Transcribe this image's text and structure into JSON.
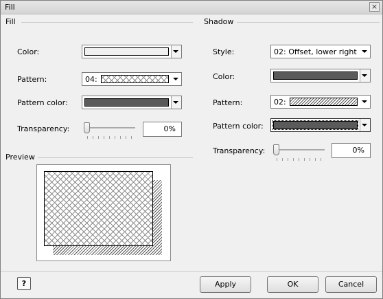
{
  "window": {
    "title": "Fill",
    "close_glyph": "×"
  },
  "fill": {
    "group_label": "Fill",
    "color_label": "Color:",
    "pattern_label": "Pattern:",
    "pattern_value": "04:",
    "pattern_color_label": "Pattern color:",
    "transparency_label": "Transparency:",
    "transparency_value": "0%",
    "color_swatch": "#f0f0f0",
    "pattern_color_swatch": "#5a5a5a"
  },
  "shadow": {
    "group_label": "Shadow",
    "style_label": "Style:",
    "style_value": "02: Offset, lower right",
    "color_label": "Color:",
    "pattern_label": "Pattern:",
    "pattern_value": "02:",
    "pattern_color_label": "Pattern color:",
    "transparency_label": "Transparency:",
    "transparency_value": "0%",
    "color_swatch": "#5a5a5a",
    "pattern_color_swatch": "#5a5a5a"
  },
  "preview": {
    "group_label": "Preview"
  },
  "buttons": {
    "help_glyph": "?",
    "apply": "Apply",
    "ok": "OK",
    "cancel": "Cancel"
  }
}
